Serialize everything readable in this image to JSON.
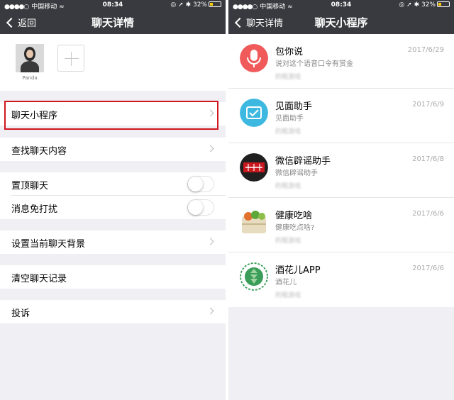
{
  "status": {
    "carrier": "中国移动",
    "time": "08:34",
    "battery": "32%",
    "battery_fraction": 0.32
  },
  "left": {
    "back_label": "返回",
    "title": "聊天详情",
    "member": {
      "name": "Panda"
    },
    "cells": {
      "mini_programs": "聊天小程序",
      "search": "查找聊天内容",
      "pin": "置顶聊天",
      "mute": "消息免打扰",
      "background": "设置当前聊天背景",
      "clear": "清空聊天记录",
      "report": "投诉"
    }
  },
  "right": {
    "back_label": "聊天详情",
    "title": "聊天小程序",
    "items": [
      {
        "name": "包你说",
        "desc": "说对这个语音口令有赏金",
        "blur": "的租游戏",
        "date": "2017/6/29",
        "icon": "microphone-icon",
        "color": "#f05a5a"
      },
      {
        "name": "见面助手",
        "desc": "见面助手",
        "blur": "的租游戏",
        "date": "2017/6/9",
        "icon": "calendar-check-icon",
        "color": "#3db8e0"
      },
      {
        "name": "微信辟谣助手",
        "desc": "微信辟谣助手",
        "blur": "的租游戏",
        "date": "2017/6/8",
        "icon": "rumor-stamp-icon",
        "color": "#1f1f1f"
      },
      {
        "name": "健康吃啥",
        "desc": "健康吃点啥?",
        "blur": "的租游戏",
        "date": "2017/6/6",
        "icon": "food-box-icon",
        "color": "#8bbf4a"
      },
      {
        "name": "酒花儿APP",
        "desc": "酒花儿",
        "blur": "的租游戏",
        "date": "2017/6/6",
        "icon": "hop-icon",
        "color": "#3a9e5a"
      }
    ]
  }
}
